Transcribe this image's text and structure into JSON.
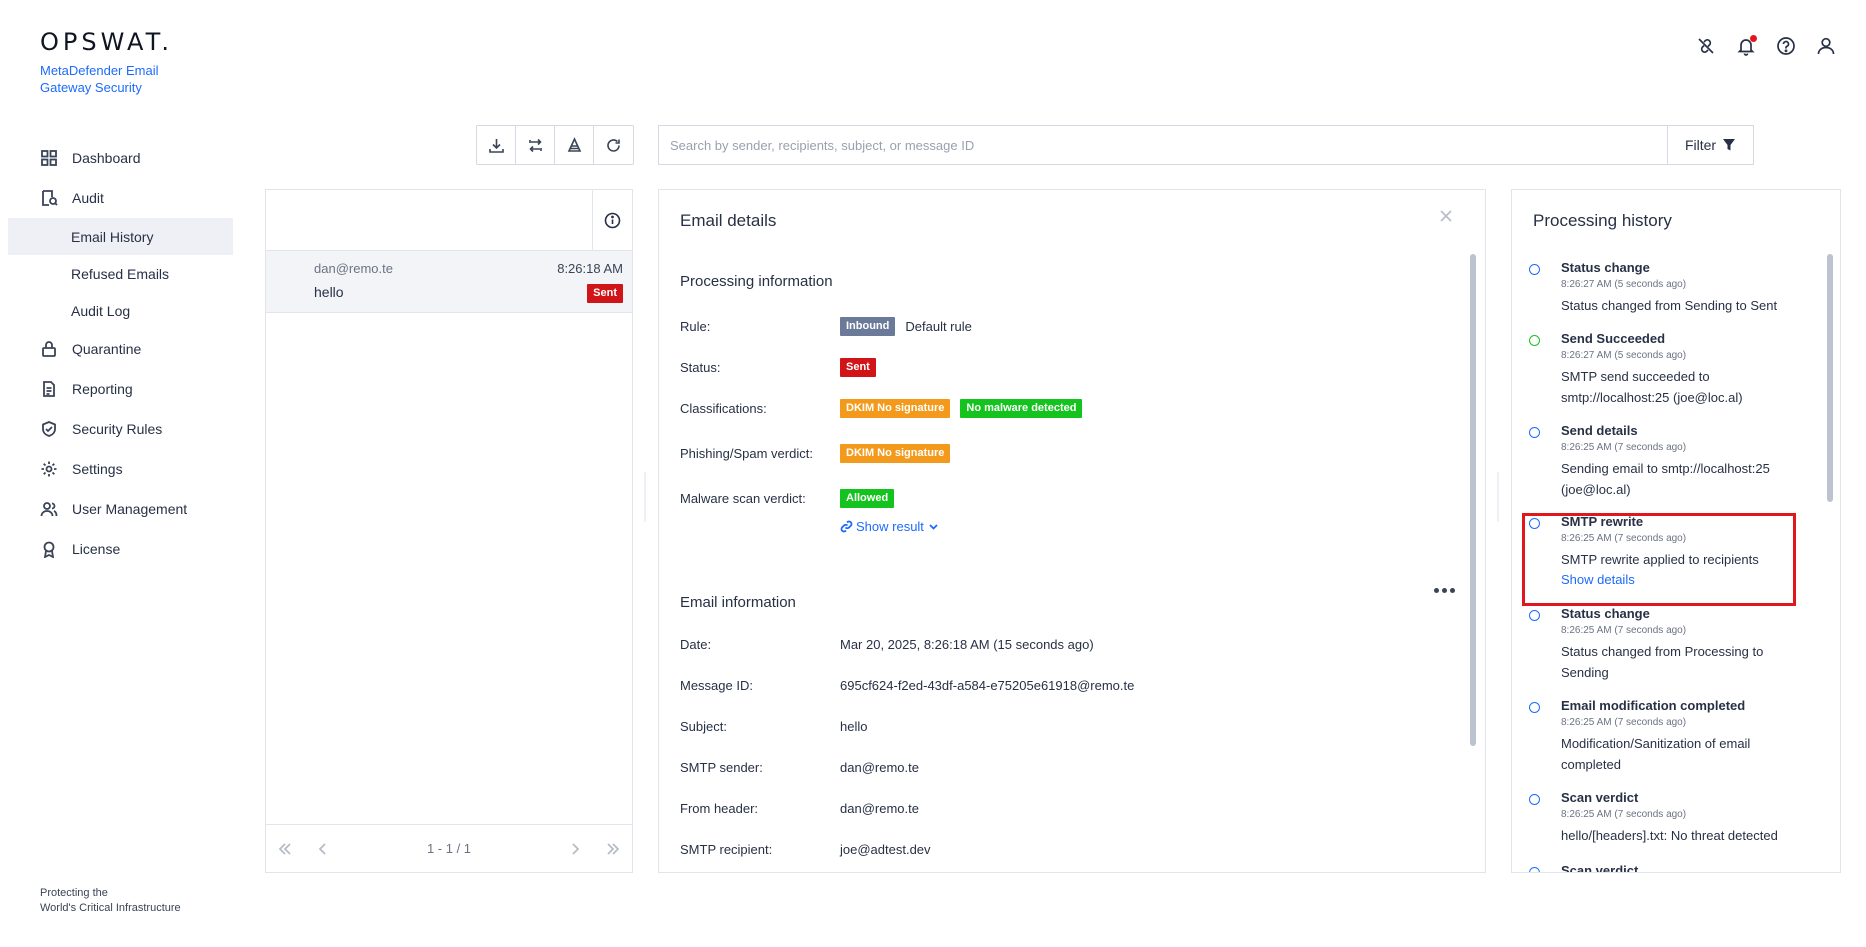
{
  "brand": {
    "logo_text": "OPSWAT.",
    "product": "MetaDefender Email Gateway Security",
    "tagline_line1": "Protecting the",
    "tagline_line2": "World's Critical Infrastructure"
  },
  "sidebar": {
    "items": [
      {
        "label": "Dashboard",
        "icon": "grid-icon"
      },
      {
        "label": "Audit",
        "icon": "audit-icon"
      },
      {
        "label": "Email History",
        "sub": true,
        "active": true
      },
      {
        "label": "Refused Emails",
        "sub": true
      },
      {
        "label": "Audit Log",
        "sub": true
      },
      {
        "label": "Quarantine",
        "icon": "lock-icon"
      },
      {
        "label": "Reporting",
        "icon": "document-icon"
      },
      {
        "label": "Security Rules",
        "icon": "shield-check-icon"
      },
      {
        "label": "Settings",
        "icon": "gear-icon"
      },
      {
        "label": "User Management",
        "icon": "users-icon"
      },
      {
        "label": "License",
        "icon": "award-icon"
      }
    ]
  },
  "header_icons": [
    "unlink-icon",
    "bell-icon",
    "help-icon",
    "user-icon"
  ],
  "toolbar": {
    "buttons": [
      "download-icon",
      "resend-icon",
      "clean-icon",
      "refresh-icon"
    ]
  },
  "search": {
    "placeholder": "Search by sender, recipients, subject, or message ID",
    "value": "",
    "filter_label": "Filter"
  },
  "email_list": {
    "rows": [
      {
        "from": "dan@remo.te",
        "time": "8:26:18 AM",
        "subject": "hello",
        "status": "Sent"
      }
    ],
    "pager_text": "1 - 1 / 1"
  },
  "details": {
    "title": "Email details",
    "processing_title": "Processing information",
    "rule_label": "Rule:",
    "rule_badge": "Inbound",
    "rule_value": "Default rule",
    "status_label": "Status:",
    "status_badge": "Sent",
    "class_label": "Classifications:",
    "class_badge1": "DKIM No signature",
    "class_badge2": "No malware detected",
    "phish_label": "Phishing/Spam verdict:",
    "phish_badge": "DKIM No signature",
    "malware_label": "Malware scan verdict:",
    "malware_badge": "Allowed",
    "show_result": "Show result",
    "email_info_title": "Email information",
    "fields": [
      {
        "label": "Date:",
        "value": "Mar 20, 2025, 8:26:18 AM (15 seconds ago)"
      },
      {
        "label": "Message ID:",
        "value": "695cf624-f2ed-43df-a584-e75205e61918@remo.te"
      },
      {
        "label": "Subject:",
        "value": "hello"
      },
      {
        "label": "SMTP sender:",
        "value": "dan@remo.te"
      },
      {
        "label": "From header:",
        "value": "dan@remo.te"
      },
      {
        "label": "SMTP recipient:",
        "value": "joe@adtest.dev"
      }
    ]
  },
  "history": {
    "title": "Processing history",
    "items": [
      {
        "title": "Status change",
        "time": "8:26:27 AM (5 seconds ago)",
        "desc": "Status changed from Sending to Sent",
        "dot": "blue"
      },
      {
        "title": "Send Succeeded",
        "time": "8:26:27 AM (5 seconds ago)",
        "desc": "SMTP send succeeded to smtp://localhost:25 (joe@loc.al)",
        "dot": "green"
      },
      {
        "title": "Send details",
        "time": "8:26:25 AM (7 seconds ago)",
        "desc": "Sending email to smtp://localhost:25 (joe@loc.al)",
        "dot": "blue"
      },
      {
        "title": "SMTP rewrite",
        "time": "8:26:25 AM (7 seconds ago)",
        "desc": "SMTP rewrite applied to recipients",
        "link": "Show details",
        "dot": "blue"
      },
      {
        "title": "Status change",
        "time": "8:26:25 AM (7 seconds ago)",
        "desc": "Status changed from Processing to Sending",
        "dot": "blue"
      },
      {
        "title": "Email modification completed",
        "time": "8:26:25 AM (7 seconds ago)",
        "desc": "Modification/Sanitization of email completed",
        "dot": "blue"
      },
      {
        "title": "Scan verdict",
        "time": "8:26:25 AM (7 seconds ago)",
        "desc": "hello/[headers].txt: No threat detected",
        "dot": "blue"
      },
      {
        "title": "Scan verdict",
        "time": "",
        "desc": "",
        "dot": "blue"
      }
    ]
  },
  "colors": {
    "accent": "#1d6bfc",
    "danger": "#d01418",
    "warning": "#f39a1c",
    "success": "#15c31e",
    "neutral_badge": "#6c7a99"
  }
}
